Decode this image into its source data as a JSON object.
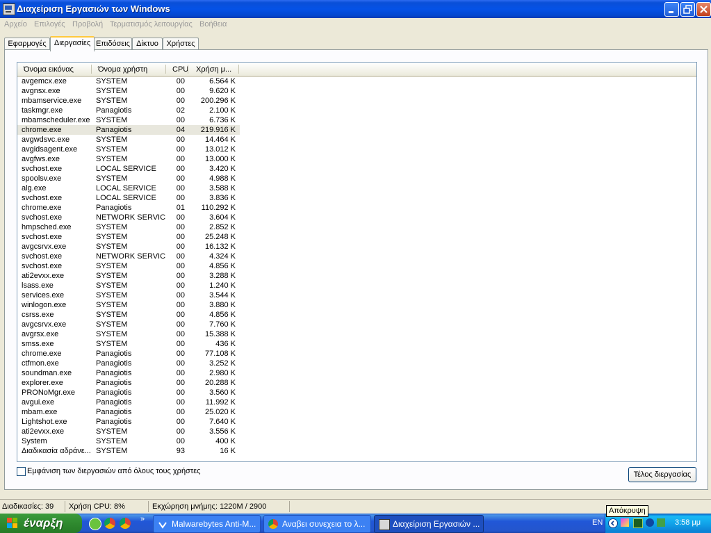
{
  "window": {
    "title": "Διαχείριση Εργασιών των Windows"
  },
  "menu": [
    "Αρχείο",
    "Επιλογές",
    "Προβολή",
    "Τερματισμός λειτουργίας",
    "Βοήθεια"
  ],
  "tabs": [
    "Εφαρμογές",
    "Διεργασίες",
    "Επιδόσεις",
    "Δίκτυο",
    "Χρήστες"
  ],
  "active_tab": "Διεργασίες",
  "columns": [
    "Όνομα εικόνας",
    "Όνομα χρήστη",
    "CPU",
    "Χρήση μ..."
  ],
  "processes": [
    {
      "name": "avgemcx.exe",
      "user": "SYSTEM",
      "cpu": "00",
      "mem": "6.564 K"
    },
    {
      "name": "avgnsx.exe",
      "user": "SYSTEM",
      "cpu": "00",
      "mem": "9.620 K"
    },
    {
      "name": "mbamservice.exe",
      "user": "SYSTEM",
      "cpu": "00",
      "mem": "200.296 K"
    },
    {
      "name": "taskmgr.exe",
      "user": "Panagiotis",
      "cpu": "02",
      "mem": "2.100 K"
    },
    {
      "name": "mbamscheduler.exe",
      "user": "SYSTEM",
      "cpu": "00",
      "mem": "6.736 K"
    },
    {
      "name": "chrome.exe",
      "user": "Panagiotis",
      "cpu": "04",
      "mem": "219.916 K"
    },
    {
      "name": "avgwdsvc.exe",
      "user": "SYSTEM",
      "cpu": "00",
      "mem": "14.464 K"
    },
    {
      "name": "avgidsagent.exe",
      "user": "SYSTEM",
      "cpu": "00",
      "mem": "13.012 K"
    },
    {
      "name": "avgfws.exe",
      "user": "SYSTEM",
      "cpu": "00",
      "mem": "13.000 K"
    },
    {
      "name": "svchost.exe",
      "user": "LOCAL SERVICE",
      "cpu": "00",
      "mem": "3.420 K"
    },
    {
      "name": "spoolsv.exe",
      "user": "SYSTEM",
      "cpu": "00",
      "mem": "4.988 K"
    },
    {
      "name": "alg.exe",
      "user": "LOCAL SERVICE",
      "cpu": "00",
      "mem": "3.588 K"
    },
    {
      "name": "svchost.exe",
      "user": "LOCAL SERVICE",
      "cpu": "00",
      "mem": "3.836 K"
    },
    {
      "name": "chrome.exe",
      "user": "Panagiotis",
      "cpu": "01",
      "mem": "110.292 K"
    },
    {
      "name": "svchost.exe",
      "user": "NETWORK SERVICE",
      "cpu": "00",
      "mem": "3.604 K"
    },
    {
      "name": "hmpsched.exe",
      "user": "SYSTEM",
      "cpu": "00",
      "mem": "2.852 K"
    },
    {
      "name": "svchost.exe",
      "user": "SYSTEM",
      "cpu": "00",
      "mem": "25.248 K"
    },
    {
      "name": "avgcsrvx.exe",
      "user": "SYSTEM",
      "cpu": "00",
      "mem": "16.132 K"
    },
    {
      "name": "svchost.exe",
      "user": "NETWORK SERVICE",
      "cpu": "00",
      "mem": "4.324 K"
    },
    {
      "name": "svchost.exe",
      "user": "SYSTEM",
      "cpu": "00",
      "mem": "4.856 K"
    },
    {
      "name": "ati2evxx.exe",
      "user": "SYSTEM",
      "cpu": "00",
      "mem": "3.288 K"
    },
    {
      "name": "lsass.exe",
      "user": "SYSTEM",
      "cpu": "00",
      "mem": "1.240 K"
    },
    {
      "name": "services.exe",
      "user": "SYSTEM",
      "cpu": "00",
      "mem": "3.544 K"
    },
    {
      "name": "winlogon.exe",
      "user": "SYSTEM",
      "cpu": "00",
      "mem": "3.880 K"
    },
    {
      "name": "csrss.exe",
      "user": "SYSTEM",
      "cpu": "00",
      "mem": "4.856 K"
    },
    {
      "name": "avgcsrvx.exe",
      "user": "SYSTEM",
      "cpu": "00",
      "mem": "7.760 K"
    },
    {
      "name": "avgrsx.exe",
      "user": "SYSTEM",
      "cpu": "00",
      "mem": "15.388 K"
    },
    {
      "name": "smss.exe",
      "user": "SYSTEM",
      "cpu": "00",
      "mem": "436 K"
    },
    {
      "name": "chrome.exe",
      "user": "Panagiotis",
      "cpu": "00",
      "mem": "77.108 K"
    },
    {
      "name": "ctfmon.exe",
      "user": "Panagiotis",
      "cpu": "00",
      "mem": "3.252 K"
    },
    {
      "name": "soundman.exe",
      "user": "Panagiotis",
      "cpu": "00",
      "mem": "2.980 K"
    },
    {
      "name": "explorer.exe",
      "user": "Panagiotis",
      "cpu": "00",
      "mem": "20.288 K"
    },
    {
      "name": "PRONoMgr.exe",
      "user": "Panagiotis",
      "cpu": "00",
      "mem": "3.560 K"
    },
    {
      "name": "avgui.exe",
      "user": "Panagiotis",
      "cpu": "00",
      "mem": "11.992 K"
    },
    {
      "name": "mbam.exe",
      "user": "Panagiotis",
      "cpu": "00",
      "mem": "25.020 K"
    },
    {
      "name": "Lightshot.exe",
      "user": "Panagiotis",
      "cpu": "00",
      "mem": "7.640 K"
    },
    {
      "name": "ati2evxx.exe",
      "user": "SYSTEM",
      "cpu": "00",
      "mem": "3.556 K"
    },
    {
      "name": "System",
      "user": "SYSTEM",
      "cpu": "00",
      "mem": "400 K"
    },
    {
      "name": "Διαδικασία αδράνε...",
      "user": "SYSTEM",
      "cpu": "93",
      "mem": "16 K"
    }
  ],
  "selected_row": 5,
  "show_all_users_label": "Εμφάνιση των διεργασιών από όλους τους χρήστες",
  "show_all_users_checked": false,
  "end_process_label": "Τέλος διεργασίας",
  "status": {
    "processes": "Διαδικασίες: 39",
    "cpu": "Χρήση CPU: 8%",
    "memory": "Εκχώρηση μνήμης: 1220M / 2900"
  },
  "taskbar": {
    "start_label": "έναρξη",
    "quicklaunch_more": "»",
    "tasks": [
      {
        "label": "Malwarebytes Anti-M...",
        "icon": "malwarebytes-icon"
      },
      {
        "label": "Αναβει συνεχεια το λ...",
        "icon": "chrome-icon"
      },
      {
        "label": "Διαχείριση Εργασιών ...",
        "icon": "task-manager-icon",
        "active": true
      }
    ],
    "language": "EN",
    "clock": "3:58 μμ",
    "tooltip": "Απόκρυψη"
  },
  "colors": {
    "title_blue": "#0552e6",
    "window_bg": "#ece9d8",
    "start_green": "#2f8a2f",
    "selected_row": "#e8e7dd",
    "tray_blue": "#11a4ea"
  }
}
